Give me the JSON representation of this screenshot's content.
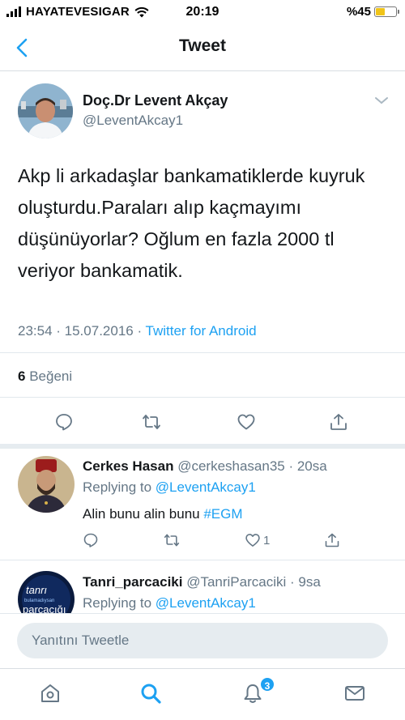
{
  "status_bar": {
    "carrier": "HAYATEVESIGAR",
    "time": "20:19",
    "battery": "%45",
    "battery_level": 0.45
  },
  "nav": {
    "title": "Tweet",
    "back_icon": "chevron-left-icon"
  },
  "tweet": {
    "author_name": "Doç.Dr Levent Akçay",
    "author_handle": "@LeventAkcay1",
    "text": "Akp li arkadaşlar bankamatiklerde kuyruk oluşturdu.Paraları alıp kaçmayımı düşünüyorlar? Oğlum en fazla 2000 tl veriyor bankamatik.",
    "timestamp": "23:54 · 15.07.2016 · ",
    "source": "Twitter for Android",
    "likes_count": "6",
    "likes_label": " Beğeni"
  },
  "replies": [
    {
      "name": "Cerkes Hasan",
      "handle_time": " @cerkeshasan35 · 20sa",
      "replying_prefix": "Replying to ",
      "replying_to": "@LeventAkcay1",
      "text": "Alin bunu alin bunu ",
      "hashtag": "#EGM",
      "like_count": "1"
    },
    {
      "name": "Tanri_parcaciki",
      "handle_time": " @TanriParcaciki · 9sa",
      "replying_prefix": "Replying to ",
      "replying_to": "@LeventAkcay1",
      "avatar_text_1": "tanrı",
      "avatar_text_2": "bulamadıysan",
      "avatar_text_3": "parçacığı"
    }
  ],
  "compose": {
    "placeholder": "Yanıtını Tweetle"
  },
  "tabbar": {
    "notifications_badge": "3"
  },
  "colors": {
    "accent": "#1da1f2",
    "secondary_text": "#657786",
    "compose_bg": "#e6ecf0"
  }
}
